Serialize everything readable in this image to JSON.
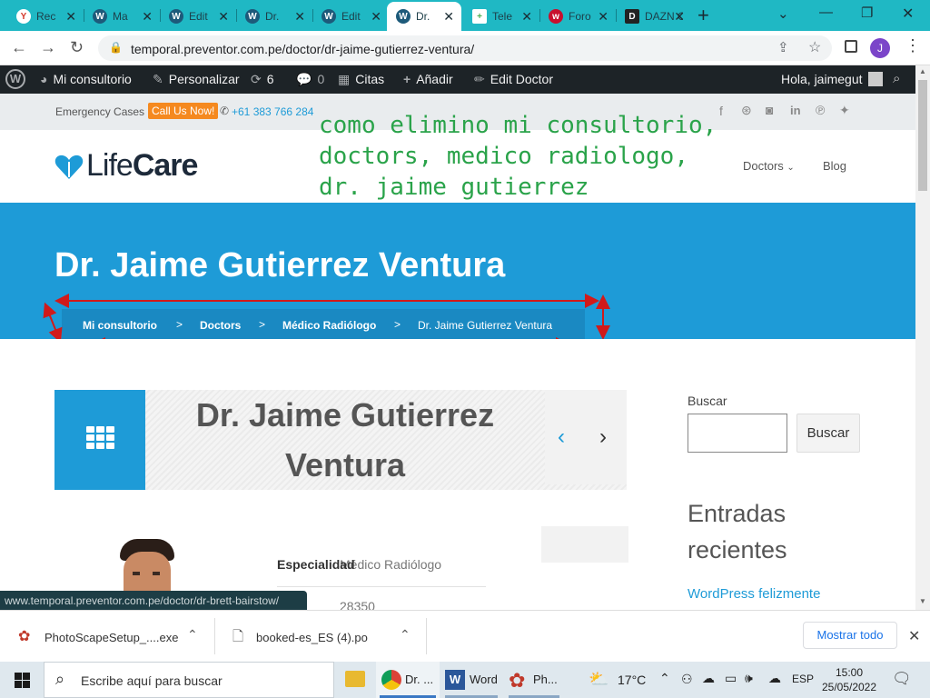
{
  "browser": {
    "tabs": [
      {
        "icon": "Y",
        "title": "Rec",
        "icon_color": "#d4392b"
      },
      {
        "icon": "W",
        "title": "Ma",
        "icon_color": "#1d5a7a"
      },
      {
        "icon": "W",
        "title": "Edit",
        "icon_color": "#1d5a7a"
      },
      {
        "icon": "W",
        "title": "Dr.",
        "icon_color": "#1d5a7a"
      },
      {
        "icon": "W",
        "title": "Edit",
        "icon_color": "#1d5a7a"
      },
      {
        "icon": "W",
        "title": "Dr.",
        "icon_color": "#1d5a7a"
      },
      {
        "icon": "+",
        "title": "Tele",
        "icon_color": "#4caf50"
      },
      {
        "icon": "w",
        "title": "Foro",
        "icon_color": "#c8102e"
      },
      {
        "icon": "D",
        "title": "DAZN C",
        "icon_color": "#222222"
      }
    ],
    "new_tab": "+",
    "url": "temporal.preventor.com.pe/doctor/dr-jaime-gutierrez-ventura/",
    "profile_initial": "J",
    "window_controls": [
      "⌄",
      "—",
      "❐",
      "✕"
    ]
  },
  "adminbar": {
    "site": "Mi consultorio",
    "customize": "Personalizar",
    "updates": "6",
    "comments": "0",
    "citas": "Citas",
    "add": "Añadir",
    "edit": "Edit Doctor",
    "greeting": "Hola, jaimegut"
  },
  "topstrip": {
    "emergency": "Emergency Cases",
    "call": "Call Us Now!",
    "phone": "+61 383 766 284"
  },
  "header": {
    "logo_light": "Life",
    "logo_bold": "Care",
    "menu": [
      "Doctors",
      "Blog"
    ]
  },
  "annotation": {
    "lines": [
      "como elimino mi consultorio,",
      "doctors, medico radiologo,",
      "dr. jaime gutierrez"
    ]
  },
  "banner": {
    "title": "Dr. Jaime Gutierrez Ventura",
    "breadcrumb": [
      "Mi consultorio",
      ">",
      "Doctors",
      ">",
      "Médico Radiólogo",
      ">",
      "Dr. Jaime Gutierrez Ventura"
    ]
  },
  "doctor_card": {
    "name_line1": "Dr. Jaime Gutierrez",
    "name_line2": "Ventura",
    "specialty_label": "Especialidad",
    "specialty_value": "Médico Radiólogo",
    "code": "28350"
  },
  "sidebar": {
    "search_label": "Buscar",
    "search_button": "Buscar",
    "recent_title_1": "Entradas",
    "recent_title_2": "recientes",
    "recent_post": "WordPress felizmente"
  },
  "status_url": "www.temporal.preventor.com.pe/doctor/dr-brett-bairstow/",
  "downloads": {
    "items": [
      "PhotoScapeSetup_....exe",
      "booked-es_ES (4).po"
    ],
    "show_all": "Mostrar todo"
  },
  "taskbar": {
    "search_placeholder": "Escribe aquí para buscar",
    "apps": [
      "Dr. ...",
      "Word",
      "Ph..."
    ],
    "weather": "17°C",
    "lang": "ESP",
    "time": "15:00",
    "date": "25/05/2022"
  },
  "colors": {
    "tabbar": "#1fb8c4",
    "banner": "#1e9bd7",
    "orange": "#f5891f",
    "annotation": "#2aa34a",
    "arrow": "#d11a1a"
  }
}
